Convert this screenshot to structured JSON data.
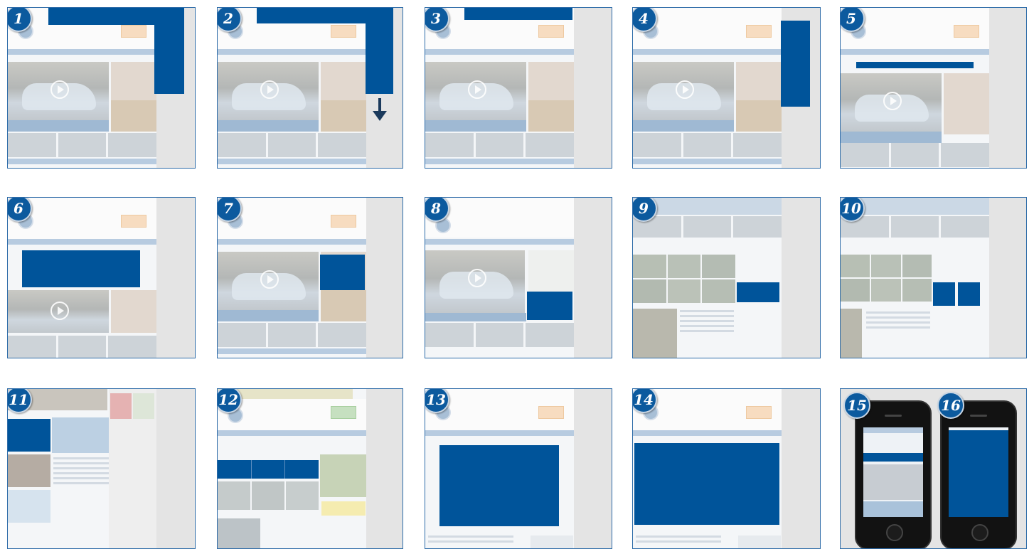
{
  "tiles": [
    {
      "number": "1"
    },
    {
      "number": "2"
    },
    {
      "number": "3"
    },
    {
      "number": "4"
    },
    {
      "number": "5"
    },
    {
      "number": "6"
    },
    {
      "number": "7"
    },
    {
      "number": "8"
    },
    {
      "number": "9"
    },
    {
      "number": "10"
    },
    {
      "number": "11"
    },
    {
      "number": "12"
    },
    {
      "number": "13"
    },
    {
      "number": "14"
    },
    {
      "number": "15"
    },
    {
      "number": "16"
    }
  ],
  "colors": {
    "ad_block": "#00549a",
    "badge": "#0c5a9e",
    "frame": "#2d6ba8",
    "background": "#e4e4e4"
  },
  "icons": {
    "down_arrow": "arrow-down-icon",
    "play": "play-icon"
  }
}
